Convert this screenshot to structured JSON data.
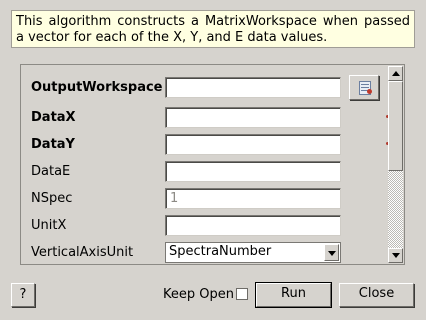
{
  "description": "This algorithm constructs a MatrixWorkspace when passed a vector for each of the X, Y, and E data values.",
  "properties": [
    {
      "label": "OutputWorkspace",
      "bold": true,
      "value": "",
      "placeholder": ""
    },
    {
      "label": "DataX",
      "bold": true,
      "value": "",
      "placeholder": ""
    },
    {
      "label": "DataY",
      "bold": true,
      "value": "",
      "placeholder": ""
    },
    {
      "label": "DataE",
      "bold": false,
      "value": "",
      "placeholder": ""
    },
    {
      "label": "NSpec",
      "bold": false,
      "value": "",
      "placeholder": "1"
    },
    {
      "label": "UnitX",
      "bold": false,
      "value": "",
      "placeholder": ""
    },
    {
      "label": "VerticalAxisUnit",
      "bold": false,
      "selected": "SpectraNumber"
    }
  ],
  "footer": {
    "help_label": "?",
    "keep_open_label": "Keep Open",
    "run_label": "Run",
    "close_label": "Close"
  },
  "icons": {
    "browse": "workspace-browse-icon",
    "required": "required-marker-icon"
  },
  "colors": {
    "background": "#d6d3ce",
    "description_bg": "#ffffe1",
    "required_marker": "#b03a2e"
  }
}
